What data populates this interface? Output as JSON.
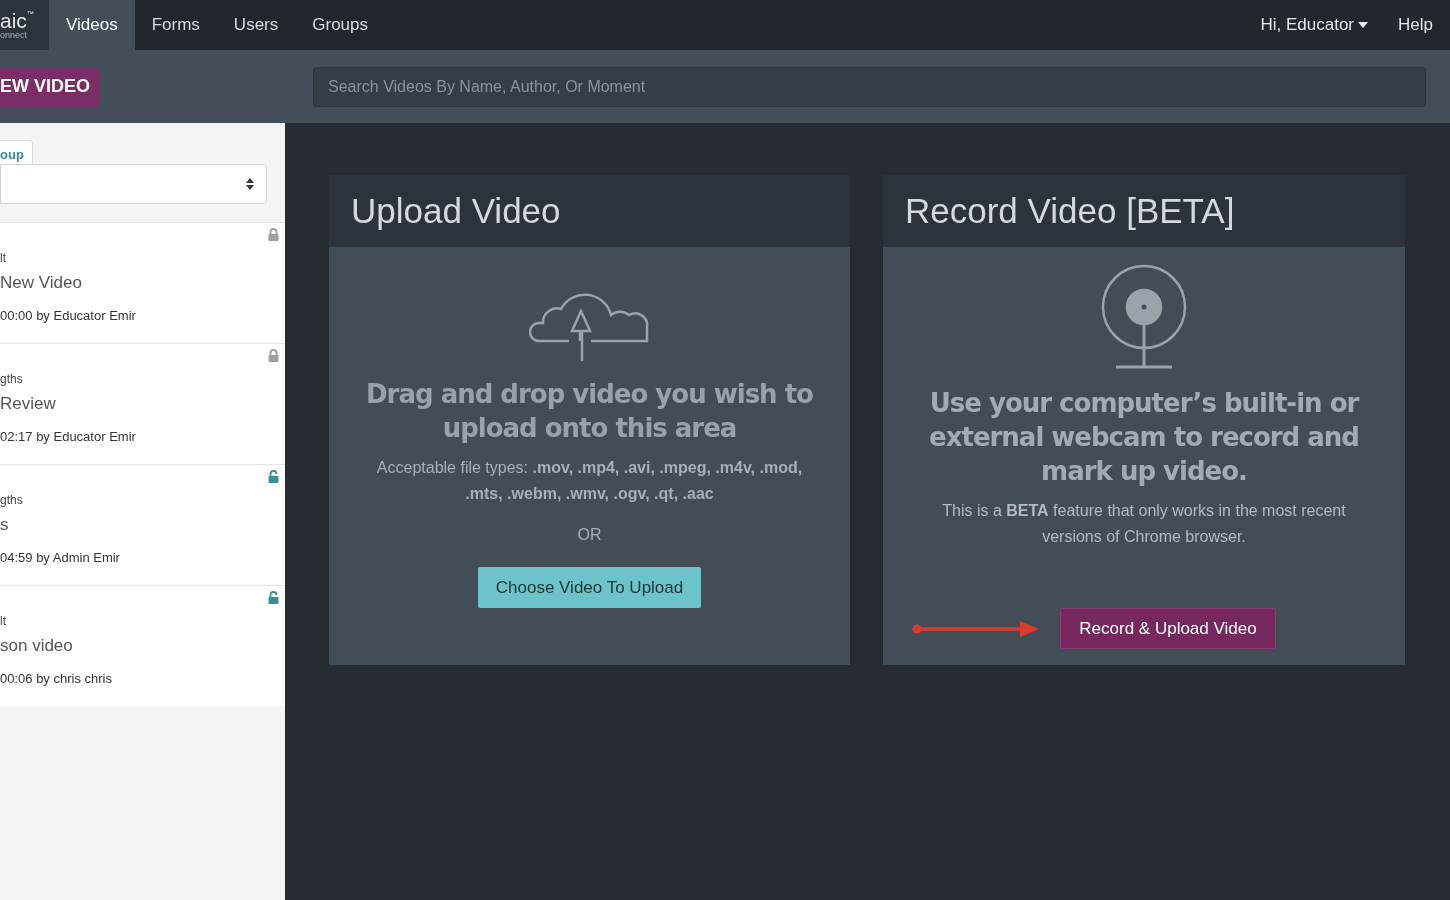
{
  "navbar": {
    "logo": {
      "mark": "aic",
      "trademark": "™",
      "subtitle": "onnect"
    },
    "tabs": [
      {
        "label": "Videos",
        "selected": true
      },
      {
        "label": "Forms",
        "selected": false
      },
      {
        "label": "Users",
        "selected": false
      },
      {
        "label": "Groups",
        "selected": false
      }
    ],
    "user_menu": "Hi, Educator",
    "help": "Help"
  },
  "toolbar": {
    "new_video_button": "EW VIDEO",
    "search": {
      "placeholder": "Search Videos By Name, Author, Or Moment"
    }
  },
  "sidebar": {
    "tab": "oup",
    "videos": [
      {
        "group": "lt",
        "title": "New Video",
        "meta": "00:00 by Educator Emir",
        "locked": true
      },
      {
        "group": "gths",
        "title": "Review",
        "meta": "02:17 by Educator Emir",
        "locked": true
      },
      {
        "group": "gths",
        "title": "s",
        "meta": "04:59 by Admin Emir",
        "locked": false
      },
      {
        "group": "lt",
        "title": "son video",
        "meta": "00:06 by chris chris",
        "locked": false
      }
    ]
  },
  "upload_card": {
    "title": "Upload Video",
    "heading": "Drag and drop video you wish to upload onto this area",
    "file_types": "Acceptable file types: **.mov, .mp4, .avi, .mpeg, .m4v, .mod, .mts, .webm, .wmv, .ogv, .qt, .aac**",
    "or": "OR",
    "button": "Choose Video To Upload"
  },
  "record_card": {
    "title": "Record Video [BETA]",
    "heading": "Use your computer’s built-in or external webcam to record and mark up video.",
    "note": "This is a **BETA** feature that only works in the most recent versions of Chrome browser.",
    "button": "Record & Upload Video"
  }
}
